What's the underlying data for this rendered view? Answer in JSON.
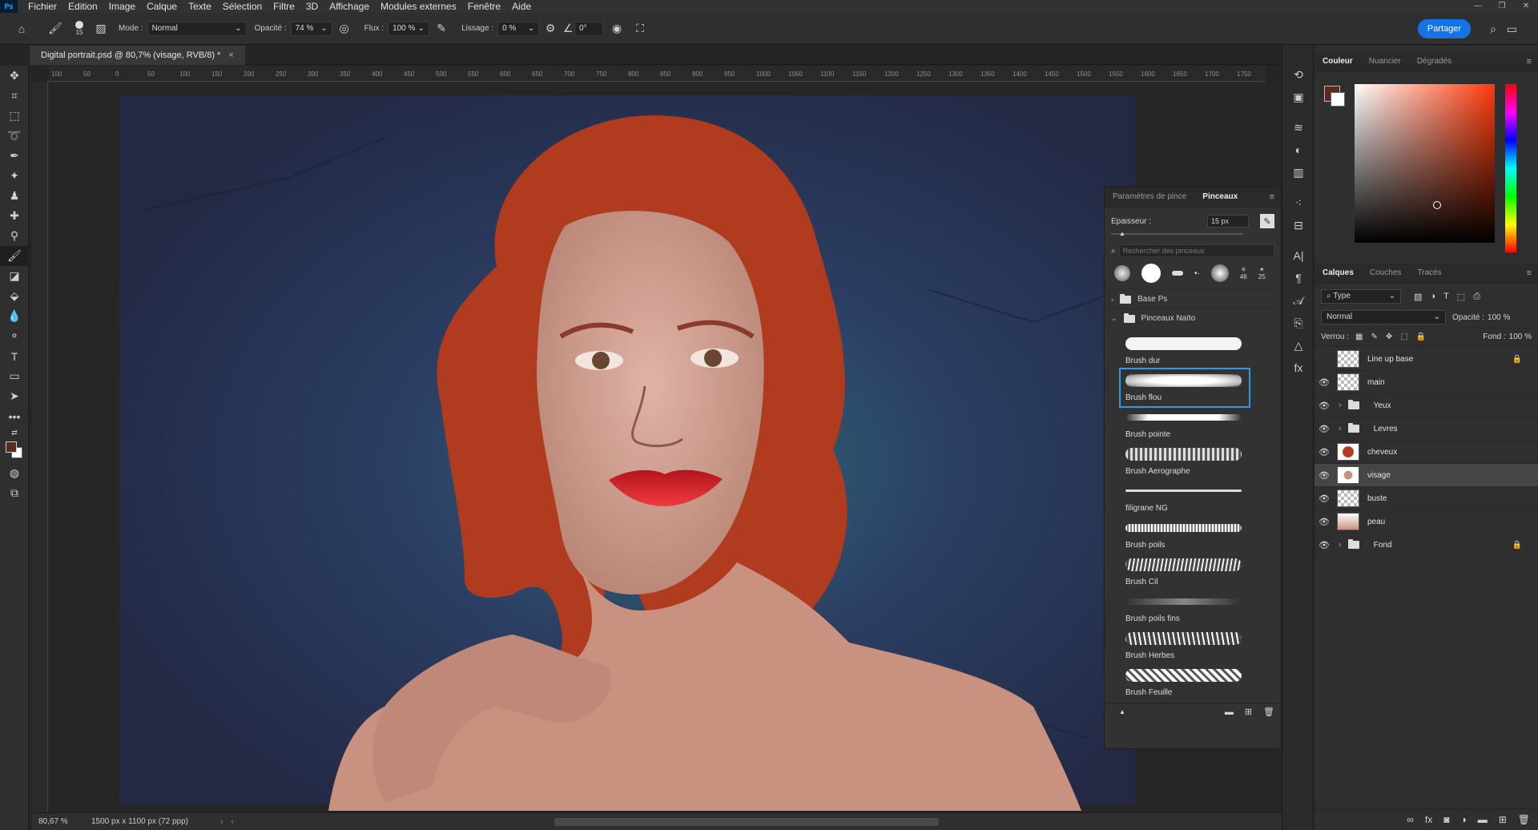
{
  "app": {
    "logo": "Ps"
  },
  "menu": [
    "Fichier",
    "Edition",
    "Image",
    "Calque",
    "Texte",
    "Sélection",
    "Filtre",
    "3D",
    "Affichage",
    "Modules externes",
    "Fenêtre",
    "Aide"
  ],
  "options": {
    "brush_size": "15",
    "mode_label": "Mode :",
    "mode_value": "Normal",
    "opacity_label": "Opacité :",
    "opacity_value": "74 %",
    "flow_label": "Flux :",
    "flow_value": "100 %",
    "smoothing_label": "Lissage :",
    "smoothing_value": "0 %",
    "angle_value": "0°"
  },
  "share": "Partager",
  "document": {
    "tab_title": "Digital portrait.psd @ 80,7% (visage, RVB/8) *",
    "close": "×"
  },
  "ruler_ticks": [
    "100",
    "50",
    "0",
    "50",
    "100",
    "150",
    "200",
    "250",
    "300",
    "350",
    "400",
    "450",
    "500",
    "550",
    "600",
    "650",
    "700",
    "750",
    "800",
    "850",
    "900",
    "950",
    "1000",
    "1050",
    "1100",
    "1150",
    "1200",
    "1250",
    "1300",
    "1350",
    "1400",
    "1450",
    "1500",
    "1550",
    "1600",
    "1650",
    "1700",
    "1750"
  ],
  "status": {
    "zoom": "80,67 %",
    "dimensions": "1500 px x 1100 px (72 ppp)"
  },
  "brush_panel": {
    "tab1": "Paramètres de pince",
    "tab2": "Pinceaux",
    "size_label": "Epaisseur :",
    "size_value": "15 px",
    "search_placeholder": "Rechercher des pinceaux",
    "preset_sizes": [
      "46",
      "25"
    ],
    "group1": "Base Ps",
    "group2": "Pinceaux Naïto",
    "brushes": [
      "Brush dur",
      "Brush flou",
      "Brush pointe",
      "Brush Aerographe",
      "filigrane NG",
      "Brush poils",
      "Brush Cil",
      "Brush poils fins",
      "Brush Herbes",
      "Brush Feuille"
    ]
  },
  "color_panel": {
    "tabs": [
      "Couleur",
      "Nuancier",
      "Dégradés"
    ],
    "foreground": "#5a2a1e",
    "hue": "#ff3a0a"
  },
  "layers_panel": {
    "tabs": [
      "Calques",
      "Couches",
      "Tracés"
    ],
    "filter": "Type",
    "blend": "Normal",
    "opacity_label": "Opacité :",
    "opacity_value": "100 %",
    "lock_label": "Verrou :",
    "fill_label": "Fond :",
    "fill_value": "100 %",
    "layers": [
      {
        "name": "Line up base",
        "type": "layer",
        "visible": false,
        "locked": true
      },
      {
        "name": "main",
        "type": "layer",
        "visible": true,
        "locked": false
      },
      {
        "name": "Yeux",
        "type": "group",
        "visible": true,
        "locked": false
      },
      {
        "name": "Levres",
        "type": "group",
        "visible": true,
        "locked": false
      },
      {
        "name": "cheveux",
        "type": "layer",
        "visible": true,
        "locked": false
      },
      {
        "name": "visage",
        "type": "layer",
        "visible": true,
        "locked": false,
        "selected": true
      },
      {
        "name": "buste",
        "type": "layer",
        "visible": true,
        "locked": false
      },
      {
        "name": "peau",
        "type": "layer",
        "visible": true,
        "locked": false
      },
      {
        "name": "Fond",
        "type": "group",
        "visible": true,
        "locked": true
      }
    ],
    "footer_icons": [
      "link-icon",
      "fx-icon",
      "mask-icon",
      "adjustment-icon",
      "folder-icon",
      "new-layer-icon",
      "trash-icon"
    ]
  },
  "colors": {
    "hair": "#b13b1f",
    "skin": "#c9917f",
    "background": "#2c3556",
    "lips": "#d8262c",
    "accent": "#1473e6"
  }
}
